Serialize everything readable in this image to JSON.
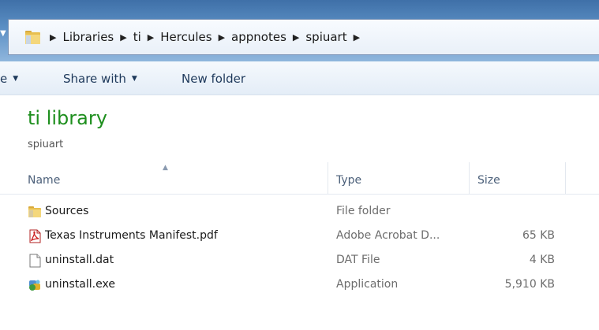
{
  "breadcrumb": [
    "Libraries",
    "ti",
    "Hercules",
    "appnotes",
    "spiuart"
  ],
  "toolbar": {
    "partial_label": "e",
    "share_label": "Share with",
    "new_folder_label": "New folder"
  },
  "library": {
    "title": "ti library",
    "subtitle": "spiuart"
  },
  "columns": {
    "name": "Name",
    "type": "Type",
    "size": "Size"
  },
  "files": [
    {
      "name": "Sources",
      "type": "File folder",
      "size": "",
      "icon": "folder-icon"
    },
    {
      "name": "Texas Instruments Manifest.pdf",
      "type": "Adobe Acrobat D...",
      "size": "65 KB",
      "icon": "pdf-icon"
    },
    {
      "name": "uninstall.dat",
      "type": "DAT File",
      "size": "4 KB",
      "icon": "file-icon"
    },
    {
      "name": "uninstall.exe",
      "type": "Application",
      "size": "5,910 KB",
      "icon": "application-icon"
    }
  ],
  "colors": {
    "library_title": "#1e8f1e",
    "titlebar": "#5b8fc4",
    "toolbar_text": "#1e395b"
  }
}
